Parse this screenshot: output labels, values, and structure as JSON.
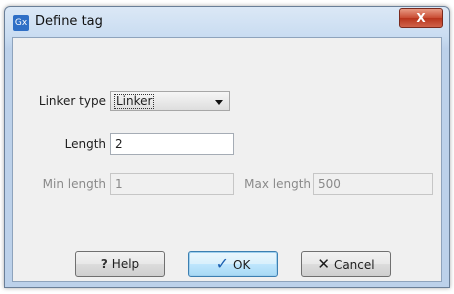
{
  "window": {
    "title": "Define tag",
    "app_icon_text": "Gx",
    "close_symbol": "X"
  },
  "form": {
    "linker_type_label": "Linker type",
    "linker_type_value": "Linker",
    "length_label": "Length",
    "length_value": "2",
    "min_length_label": "Min length",
    "min_length_value": "1",
    "max_length_label": "Max length",
    "max_length_value": "500"
  },
  "buttons": {
    "help_icon": "?",
    "help_label": "Help",
    "ok_icon": "✓",
    "ok_label": "OK",
    "cancel_icon": "✕",
    "cancel_label": "Cancel"
  }
}
